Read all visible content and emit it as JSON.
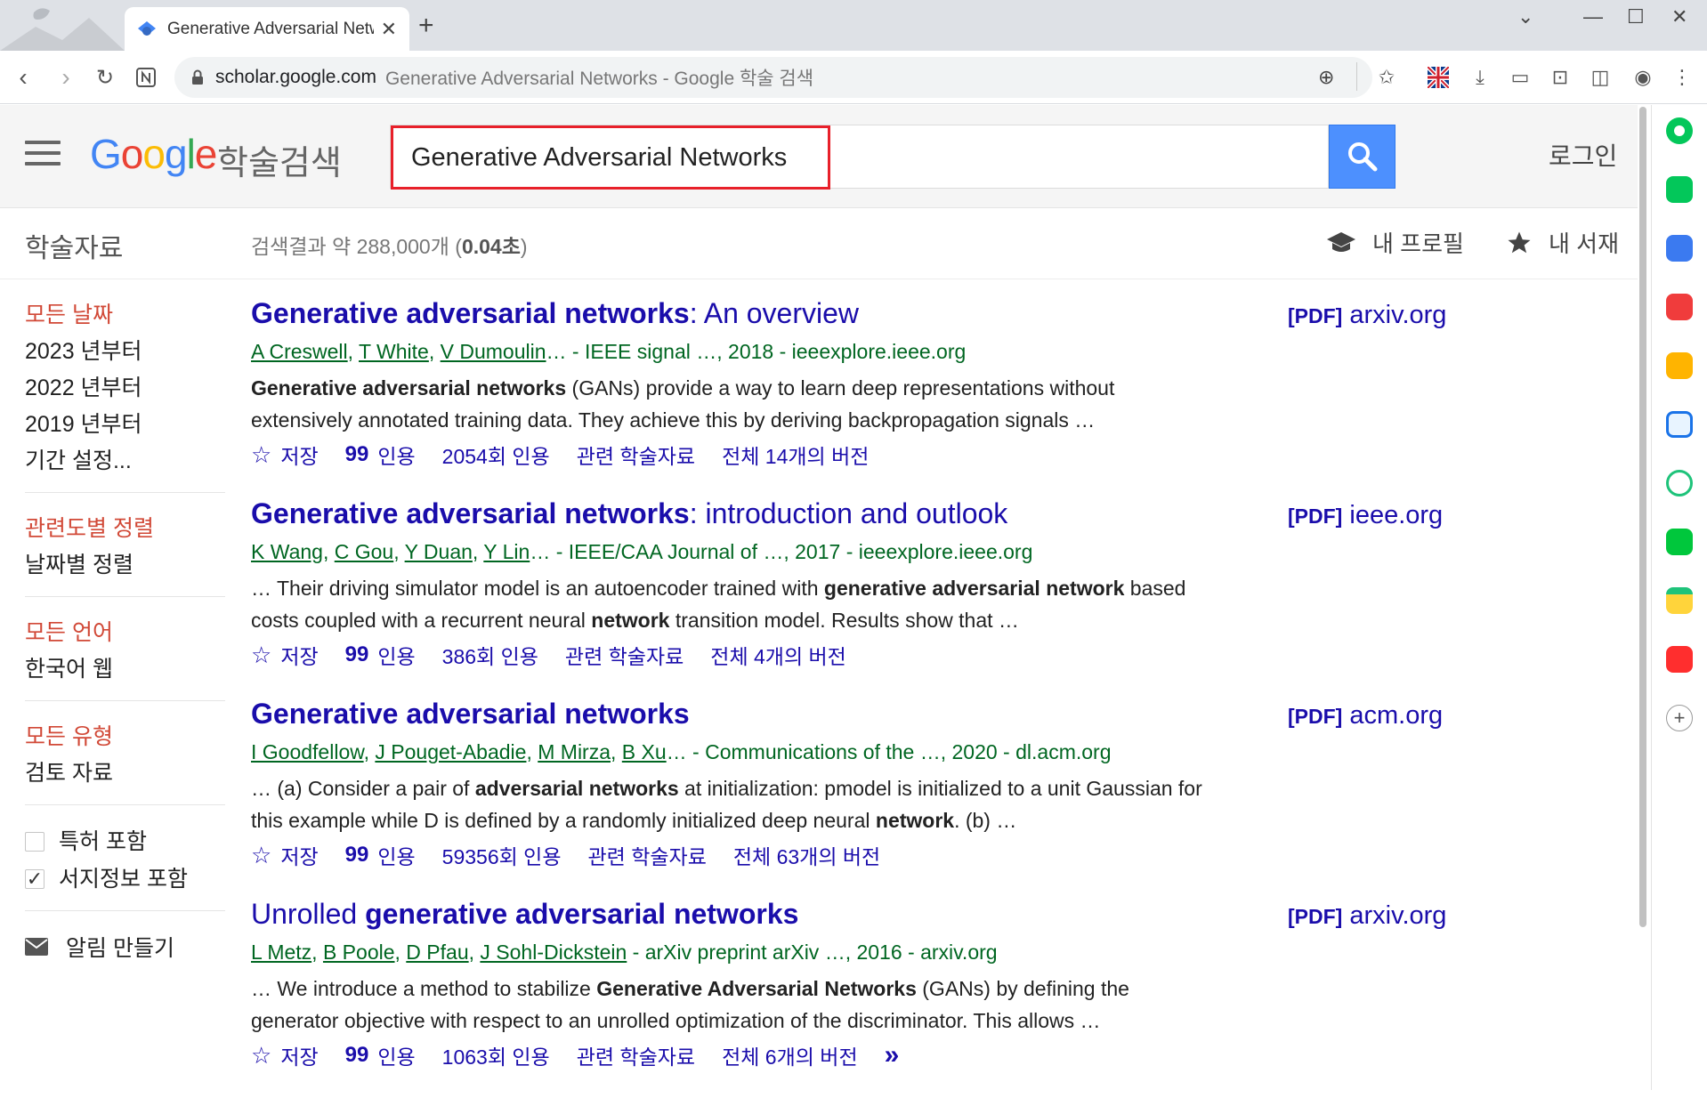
{
  "browser": {
    "tab_title": "Generative Adversarial Network",
    "url_host": "scholar.google.com",
    "url_rest": "Generative Adversarial Networks - Google 학술 검색"
  },
  "header": {
    "logo_letters": [
      "G",
      "o",
      "o",
      "g",
      "l",
      "e"
    ],
    "logo_suffix": "학술검색",
    "search_value": "Generative Adversarial Networks",
    "login_label": "로그인"
  },
  "subheader": {
    "title": "학술자료",
    "count_text": "검색결과 약 288,000개 (",
    "count_time": "0.04초",
    "count_close": ")",
    "profile_label": "내 프로필",
    "library_label": "내 서재"
  },
  "filters": {
    "date": [
      "모든 날짜",
      "2023 년부터",
      "2022 년부터",
      "2019 년부터",
      "기간 설정..."
    ],
    "sort": [
      "관련도별 정렬",
      "날짜별 정렬"
    ],
    "language": [
      "모든 언어",
      "한국어 웹"
    ],
    "type": [
      "모든 유형",
      "검토 자료"
    ],
    "checks": [
      {
        "label": "특허 포함",
        "checked": false
      },
      {
        "label": "서지정보 포함",
        "checked": true
      }
    ],
    "alert_label": "알림 만들기"
  },
  "actions": {
    "save": "저장",
    "cite": "인용"
  },
  "results": [
    {
      "title_bold": "Generative adversarial networks",
      "title_rest": ": An overview",
      "authors": [
        "A Creswell",
        "T White",
        "V Dumoulin"
      ],
      "meta_rest": "… - IEEE signal …, 2018 - ieeexplore.ieee.org",
      "snippet_html": "<b>Generative adversarial networks</b> (GANs) provide a way to learn deep representations without extensively annotated training data. They achieve this by deriving backpropagation signals …",
      "cited": "2054회 인용",
      "related": "관련 학술자료",
      "versions": "전체 14개의 버전",
      "pdf_tag": "[PDF]",
      "pdf_source": "arxiv.org"
    },
    {
      "title_bold": "Generative adversarial networks",
      "title_rest": ": introduction and outlook",
      "authors": [
        "K Wang",
        "C Gou",
        "Y Duan",
        "Y Lin"
      ],
      "meta_rest": "… - IEEE/CAA Journal of …, 2017 - ieeexplore.ieee.org",
      "snippet_html": "… Their driving simulator model is an autoencoder trained with <b>generative adversarial network</b> based costs coupled with a recurrent neural <b>network</b> transition model. Results show that …",
      "cited": "386회 인용",
      "related": "관련 학술자료",
      "versions": "전체 4개의 버전",
      "pdf_tag": "[PDF]",
      "pdf_source": "ieee.org"
    },
    {
      "title_bold": "Generative adversarial networks",
      "title_rest": "",
      "authors": [
        "I Goodfellow",
        "J Pouget-Abadie",
        "M Mirza",
        "B Xu"
      ],
      "meta_rest": "… - Communications of the …, 2020 - dl.acm.org",
      "snippet_html": "… (a) Consider a pair of <b>adversarial networks</b> at initialization: pmodel is initialized to a unit Gaussian for this example while D is defined by a randomly initialized deep neural <b>network</b>. (b) …",
      "cited": "59356회 인용",
      "related": "관련 학술자료",
      "versions": "전체 63개의 버전",
      "pdf_tag": "[PDF]",
      "pdf_source": "acm.org"
    },
    {
      "title_prefix": "Unrolled ",
      "title_bold": "generative adversarial networks",
      "title_rest": "",
      "authors": [
        "L Metz",
        "B Poole",
        "D Pfau",
        "J Sohl-Dickstein"
      ],
      "meta_rest": " - arXiv preprint arXiv …, 2016 - arxiv.org",
      "snippet_html": "… We introduce a method to stabilize <b>Generative Adversarial Networks</b> (GANs) by defining the generator objective with respect to an unrolled optimization of the discriminator. This allows …",
      "cited": "1063회 인용",
      "related": "관련 학술자료",
      "versions": "전체 6개의 버전",
      "pdf_tag": "[PDF]",
      "pdf_source": "arxiv.org",
      "more": "»"
    }
  ],
  "colors": {
    "link": "#1a0dab",
    "green": "#006621",
    "filter_selected": "#d14836",
    "search_button": "#4d90fe",
    "highlight_box": "#e8202a"
  }
}
